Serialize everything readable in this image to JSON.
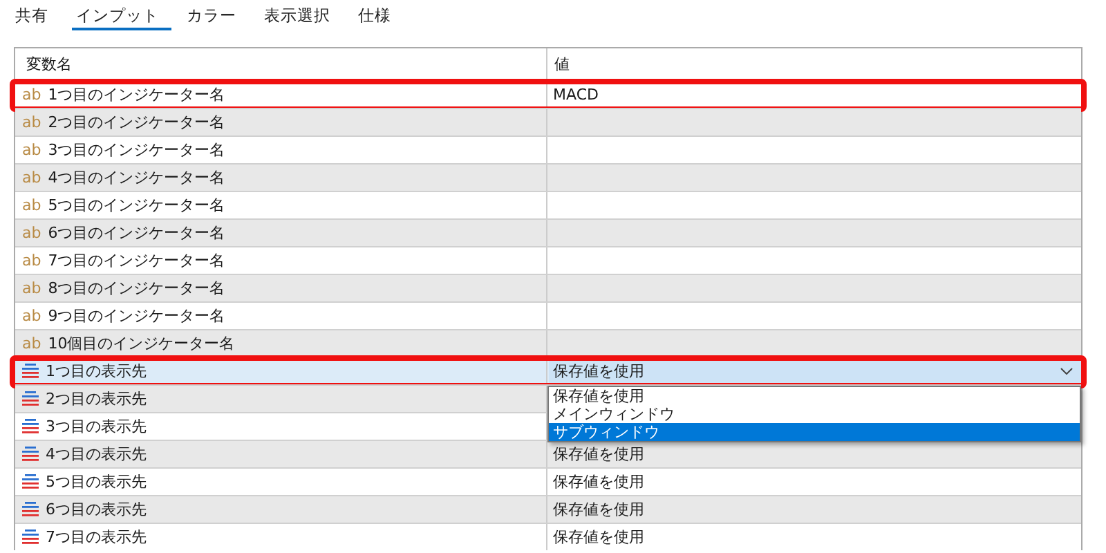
{
  "tabs": [
    {
      "label": "共有",
      "selected": false
    },
    {
      "label": "インプット",
      "selected": true
    },
    {
      "label": "カラー",
      "selected": false
    },
    {
      "label": "表示選択",
      "selected": false
    },
    {
      "label": "仕様",
      "selected": false
    }
  ],
  "table": {
    "columns": [
      "変数名",
      "値"
    ],
    "rows": [
      {
        "kind": "string",
        "icon_text": "ab",
        "name": "1つ目のインジケーター名",
        "value": "MACD",
        "selected": false,
        "highlighted": true
      },
      {
        "kind": "string",
        "icon_text": "ab",
        "name": "2つ目のインジケーター名",
        "selected": false,
        "highlighted": false
      },
      {
        "kind": "string",
        "icon_text": "ab",
        "name": "3つ目のインジケーター名",
        "selected": false,
        "highlighted": false
      },
      {
        "kind": "string",
        "icon_text": "ab",
        "name": "4つ目のインジケーター名",
        "selected": false,
        "highlighted": false
      },
      {
        "kind": "string",
        "icon_text": "ab",
        "name": "5つ目のインジケーター名",
        "selected": false,
        "highlighted": false
      },
      {
        "kind": "string",
        "icon_text": "ab",
        "name": "6つ目のインジケーター名",
        "selected": false,
        "highlighted": false
      },
      {
        "kind": "string",
        "icon_text": "ab",
        "name": "7つ目のインジケーター名",
        "selected": false,
        "highlighted": false
      },
      {
        "kind": "string",
        "icon_text": "ab",
        "name": "8つ目のインジケーター名",
        "selected": false,
        "highlighted": false
      },
      {
        "kind": "string",
        "icon_text": "ab",
        "name": "9つ目のインジケーター名",
        "selected": false,
        "highlighted": false
      },
      {
        "kind": "string",
        "icon_text": "ab",
        "name": "10個目のインジケーター名",
        "selected": false,
        "highlighted": false
      },
      {
        "kind": "enum",
        "name": "1つ目の表示先",
        "value": "保存値を使用",
        "selected": true,
        "highlighted": true,
        "dropdown": {
          "options": [
            {
              "label": "保存値を使用",
              "selected": false
            },
            {
              "label": "メインウィンドウ",
              "selected": false
            },
            {
              "label": "サブウィンドウ",
              "selected": true
            }
          ]
        }
      },
      {
        "kind": "enum",
        "name": "2つ目の表示先",
        "selected": false,
        "highlighted": false
      },
      {
        "kind": "enum",
        "name": "3つ目の表示先",
        "selected": false,
        "highlighted": false
      },
      {
        "kind": "enum",
        "name": "4つ目の表示先",
        "value": "保存値を使用",
        "selected": false,
        "highlighted": false
      },
      {
        "kind": "enum",
        "name": "5つ目の表示先",
        "value": "保存値を使用",
        "selected": false,
        "highlighted": false
      },
      {
        "kind": "enum",
        "name": "6つ目の表示先",
        "value": "保存値を使用",
        "selected": false,
        "highlighted": false
      },
      {
        "kind": "enum",
        "name": "7つ目の表示先",
        "value": "保存値を使用",
        "selected": false,
        "highlighted": false
      }
    ]
  }
}
